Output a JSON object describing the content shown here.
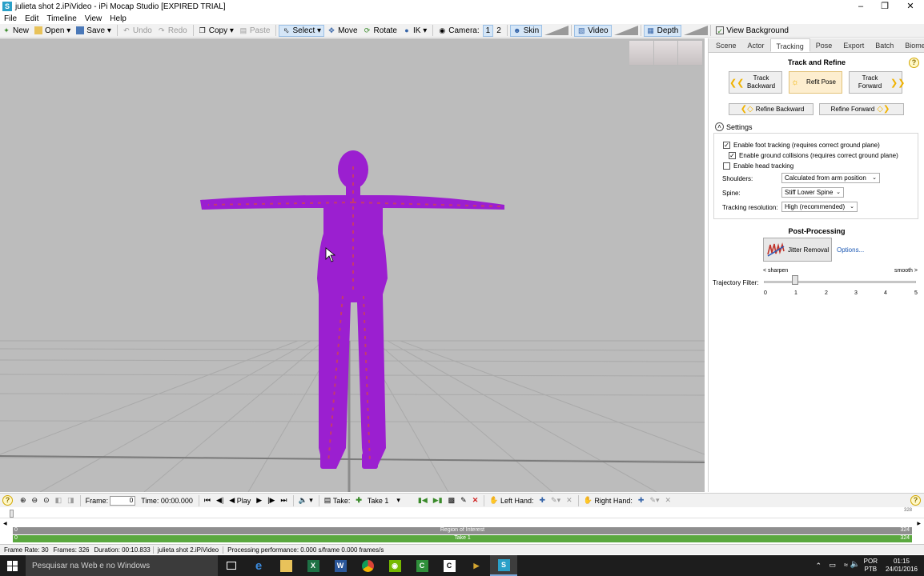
{
  "window": {
    "title": "julieta shot 2.iPiVideo - iPi Mocap Studio [EXPIRED TRIAL]"
  },
  "menu": [
    "File",
    "Edit",
    "Timeline",
    "View",
    "Help"
  ],
  "toolbar": {
    "new": "New",
    "open": "Open",
    "save": "Save",
    "undo": "Undo",
    "redo": "Redo",
    "copy": "Copy",
    "paste": "Paste",
    "select": "Select",
    "move": "Move",
    "rotate": "Rotate",
    "ik": "IK",
    "camera": "Camera:",
    "cam1": "1",
    "cam2": "2",
    "skin": "Skin",
    "video": "Video",
    "depth": "Depth",
    "view_background": "View Background"
  },
  "panel": {
    "tabs": [
      "Scene",
      "Actor",
      "Tracking",
      "Pose",
      "Export",
      "Batch",
      "Biomech"
    ],
    "active_tab": "Tracking",
    "track_refine_title": "Track and Refine",
    "track_backward": "Track Backward",
    "refit_pose": "Refit Pose",
    "track_forward": "Track Forward",
    "refine_backward": "Refine Backward",
    "refine_forward": "Refine Forward",
    "settings": "Settings",
    "foot_tracking": "Enable foot tracking (requires correct ground plane)",
    "ground_collisions": "Enable ground collisions (requires correct ground plane)",
    "head_tracking": "Enable head tracking",
    "shoulders_label": "Shoulders:",
    "shoulders_value": "Calculated from arm position",
    "spine_label": "Spine:",
    "spine_value": "Stiff Lower Spine",
    "resolution_label": "Tracking resolution:",
    "resolution_value": "High (recommended)",
    "post_processing": "Post-Processing",
    "jitter_removal": "Jitter Removal",
    "options": "Options...",
    "sharpen": "< sharpen",
    "smooth": "smooth >",
    "trajectory_filter": "Trajectory Filter:",
    "filter_value": 1,
    "ticks": [
      "0",
      "1",
      "2",
      "3",
      "4",
      "5"
    ]
  },
  "checkboxes": {
    "foot_tracking": true,
    "ground_collisions": true,
    "head_tracking": false
  },
  "timeline": {
    "frame_label": "Frame:",
    "frame_value": "0",
    "time_label": "Time:",
    "time_value": "00:00.000",
    "play": "Play",
    "take_label": "Take:",
    "take_value": "Take 1",
    "left_hand": "Left Hand:",
    "right_hand": "Right Hand:",
    "end_frame": "328",
    "roi_label": "Region of Interest",
    "roi_start": "0",
    "roi_end": "324",
    "take_bar_label": "Take 1",
    "take_start": "0",
    "take_end": "324"
  },
  "status": {
    "frame_rate": "Frame Rate: 30",
    "frames": "Frames: 326",
    "duration": "Duration: 00:10.833",
    "file": "julieta shot 2.iPiVideo",
    "performance": "Processing performance: 0.000 s/frame 0.000 frames/s"
  },
  "taskbar": {
    "search": "Pesquisar na Web e no Windows",
    "lang1": "POR",
    "lang2": "PTB",
    "time": "01:15",
    "date": "24/01/2016"
  }
}
